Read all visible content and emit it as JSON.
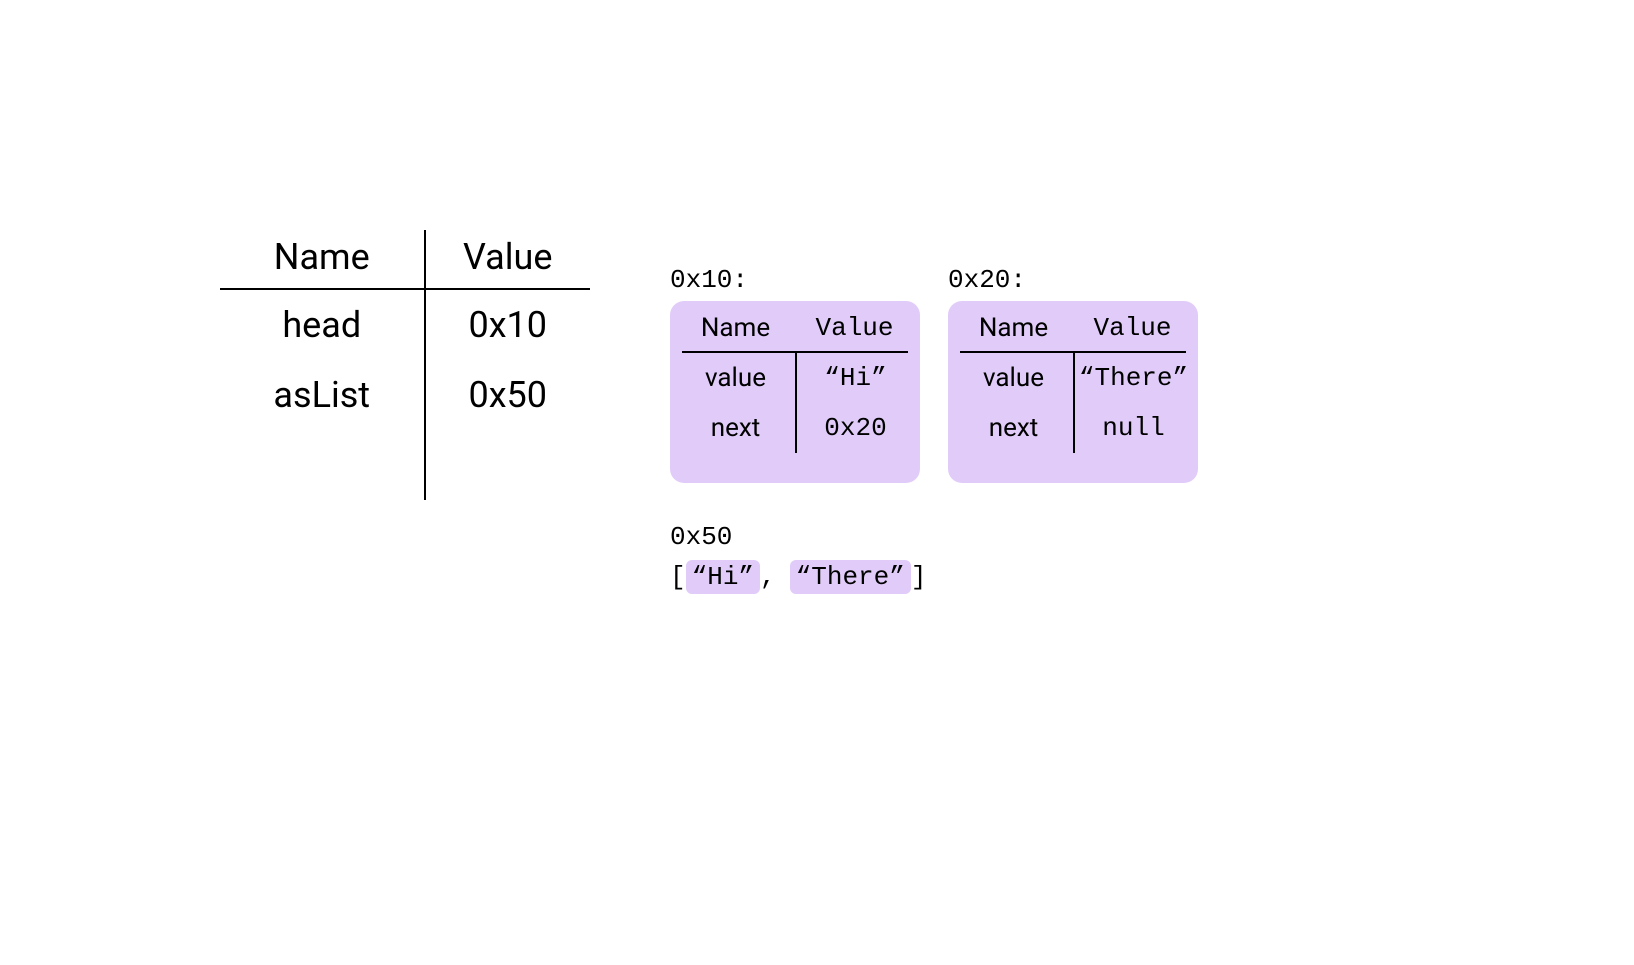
{
  "main_table": {
    "header": {
      "name": "Name",
      "value": "Value"
    },
    "rows": [
      {
        "name": "head",
        "value": "0x10"
      },
      {
        "name": "asList",
        "value": "0x50"
      }
    ]
  },
  "heap": [
    {
      "address": "0x10:",
      "header": {
        "name": "Name",
        "value": "Value"
      },
      "rows": [
        {
          "name": "value",
          "value": "“Hi”"
        },
        {
          "name": "next",
          "value": "0x20"
        }
      ]
    },
    {
      "address": "0x20:",
      "header": {
        "name": "Name",
        "value": "Value"
      },
      "rows": [
        {
          "name": "value",
          "value": "“There”"
        },
        {
          "name": "next",
          "value": "null"
        }
      ]
    }
  ],
  "array": {
    "address": "0x50",
    "open": "[",
    "close": "]",
    "sep": ",",
    "elements": [
      "“Hi”",
      "“There”"
    ]
  },
  "colors": {
    "heap_fill": "#E1CCF9"
  }
}
